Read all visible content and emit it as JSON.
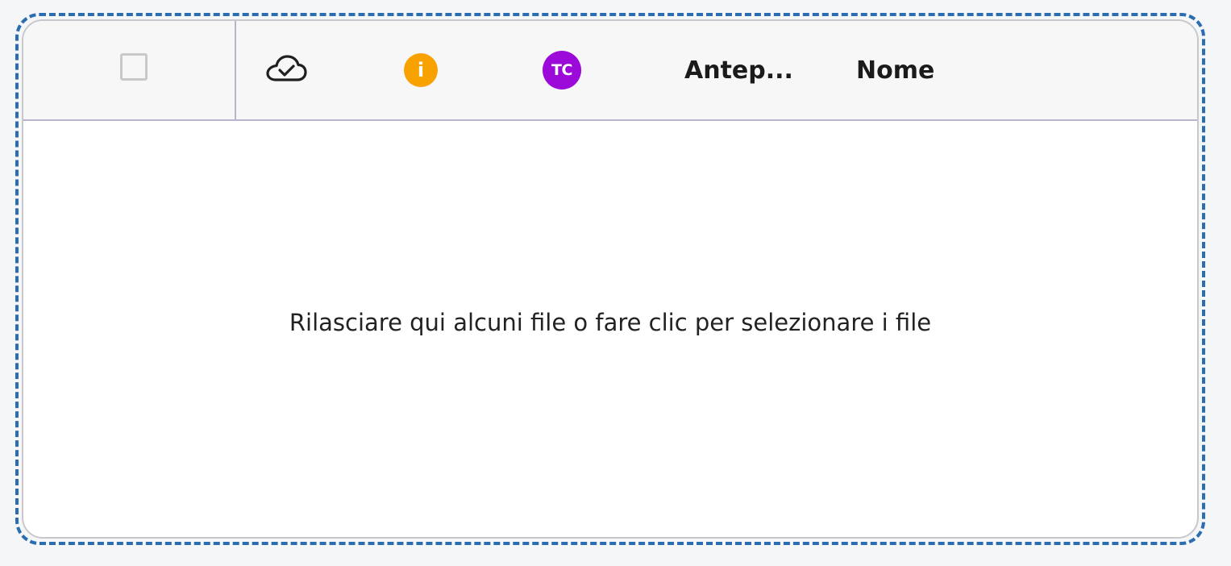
{
  "header": {
    "select_all_checked": false,
    "columns": {
      "sync_status": {
        "icon": "cloud-check-icon"
      },
      "info": {
        "icon": "info-icon",
        "glyph": "i",
        "color": "#f7a200"
      },
      "author": {
        "icon": "avatar-icon",
        "initials": "TC",
        "color": "#9b0ad8"
      },
      "preview": {
        "label": "Antep..."
      },
      "name": {
        "label": "Nome"
      }
    }
  },
  "dropzone": {
    "message": "Rilasciare qui alcuni file o fare clic per selezionare i file",
    "border_color": "#2a6db0"
  }
}
